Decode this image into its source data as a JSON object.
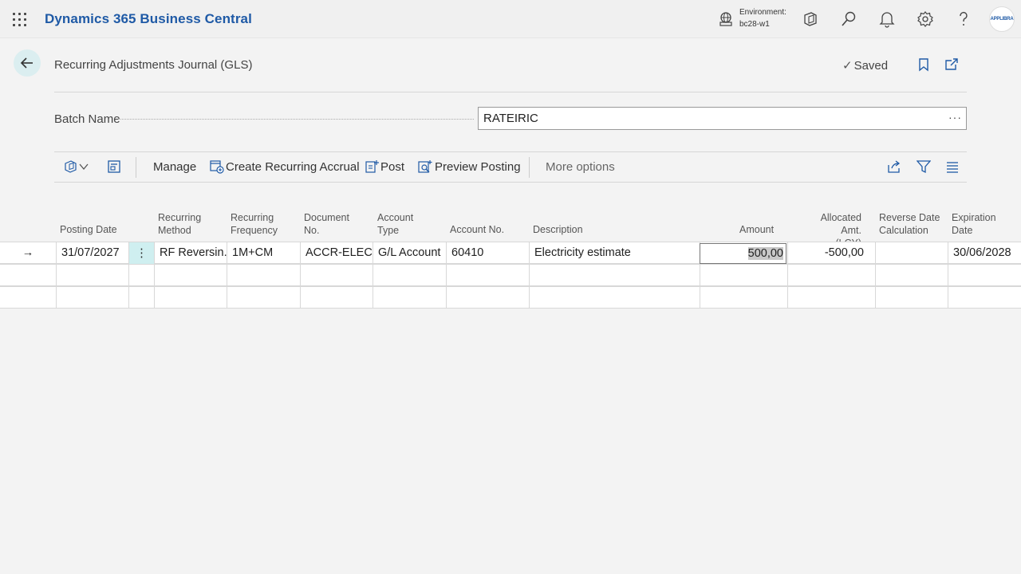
{
  "app": {
    "title": "Dynamics 365 Business Central",
    "environment_label": "Environment:",
    "environment_value": "bc28-w1",
    "avatar_text": "APPLIBRA"
  },
  "page": {
    "title": "Recurring Adjustments Journal (GLS)",
    "status": "Saved"
  },
  "batch": {
    "label": "Batch Name",
    "value": "RATEIRIC",
    "lookup": "···"
  },
  "actions": {
    "manage": "Manage",
    "create_recurring_accrual": "Create Recurring Accrual",
    "post": "Post",
    "preview_posting": "Preview Posting",
    "more_options": "More options"
  },
  "columns": [
    {
      "line1": "",
      "line2": "Posting Date"
    },
    {
      "line1": "Recurring",
      "line2": "Method"
    },
    {
      "line1": "Recurring",
      "line2": "Frequency"
    },
    {
      "line1": "Document",
      "line2": "No."
    },
    {
      "line1": "Account",
      "line2": "Type"
    },
    {
      "line1": "",
      "line2": "Account No."
    },
    {
      "line1": "",
      "line2": "Description"
    },
    {
      "line1": "",
      "line2": "Amount"
    },
    {
      "line1": "Allocated Amt.",
      "line2": "(LCY)"
    },
    {
      "line1": "Reverse Date",
      "line2": "Calculation"
    },
    {
      "line1": "Expiration",
      "line2": "Date"
    }
  ],
  "rows": [
    {
      "indicator": "→",
      "posting_date": "31/07/2027",
      "menu": "⋮",
      "recurring_method": "RF Reversin...",
      "recurring_frequency": "1M+CM",
      "document_no": "ACCR-ELEC",
      "account_type": "G/L Account",
      "account_no": "60410",
      "description": "Electricity estimate",
      "amount": "500,00",
      "allocated_amt": "-500,00",
      "reverse_date_calc": "",
      "expiration_date": "30/06/2028"
    }
  ],
  "colors": {
    "brand": "#1f5aa6",
    "selected_cell": "#cfeff0",
    "back_button": "#dbeef0"
  }
}
